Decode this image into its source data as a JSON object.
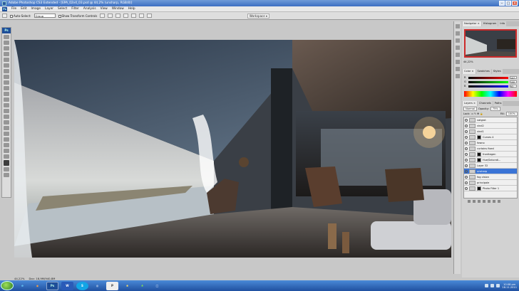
{
  "window": {
    "title": "Adobe Photoshop CS3 Extended - [EPA_02v4_03.psd @ 44,2% (unsharp, RGB/8)]"
  },
  "menu": {
    "items": [
      "File",
      "Edit",
      "Image",
      "Layer",
      "Select",
      "Filter",
      "Analysis",
      "View",
      "Window",
      "Help"
    ]
  },
  "options": {
    "auto_select_label": "Auto-Select:",
    "auto_select_value": "Group",
    "show_transform_label": "Show Transform Controls",
    "workspace_label": "Workspace ▾"
  },
  "toolbox": {
    "badge": "Ps"
  },
  "status": {
    "zoom": "44,22%",
    "doc": "Doc: 18,9M/940,8M"
  },
  "panels": {
    "navigator_tabs": [
      "Navigator ×",
      "Histogram",
      "Info"
    ],
    "navigator_zoom": "44,22%",
    "color_tabs": [
      "Color ×",
      "Swatches",
      "Styles"
    ],
    "color_rows": [
      {
        "label": "R",
        "value": "107",
        "gradient": "#ff0000"
      },
      {
        "label": "G",
        "value": "100",
        "gradient": "#00ff00"
      },
      {
        "label": "B",
        "value": "93",
        "gradient": "#0000ff"
      }
    ],
    "layer_tabs": [
      "Layers ×",
      "Channels",
      "Paths"
    ],
    "blend_mode": "Normal",
    "opacity_label": "Opacity:",
    "opacity_value": "75%",
    "lock_label": "Lock:",
    "fill_label": "Fill:",
    "fill_value": "100%",
    "layers": [
      {
        "name": "vatgrot",
        "selected": false,
        "mask": false
      },
      {
        "name": "vind2",
        "selected": false,
        "mask": false
      },
      {
        "name": "vind1",
        "selected": false,
        "mask": false
      },
      {
        "name": "Curves 4",
        "selected": false,
        "mask": true
      },
      {
        "name": "fowno",
        "selected": false,
        "mask": false
      },
      {
        "name": "curtains fixed",
        "selected": false,
        "mask": false
      },
      {
        "name": "fronttegen",
        "selected": false,
        "mask": true
      },
      {
        "name": "Hue/Saturati...",
        "selected": false,
        "mask": true
      },
      {
        "name": "Layer 32",
        "selected": false,
        "mask": false
      },
      {
        "name": "unsharp",
        "selected": true,
        "mask": false
      },
      {
        "name": "fog vision",
        "selected": false,
        "mask": false
      },
      {
        "name": "principale",
        "selected": false,
        "mask": false
      },
      {
        "name": "Photo Filter 1",
        "selected": false,
        "mask": true
      }
    ]
  },
  "taskbar": {
    "apps": [
      "e",
      "◉",
      "Ps",
      "W",
      "S",
      "◎",
      "P",
      "❀",
      "♣",
      "□"
    ],
    "clock_time": "10:08 pm",
    "clock_date": "18.11.2011"
  }
}
